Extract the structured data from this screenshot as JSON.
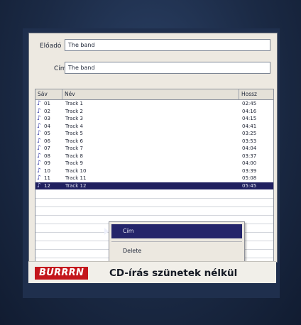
{
  "form": {
    "artist_label": "Előadó",
    "artist_value": "The band",
    "title_label": "Cím",
    "title_value": "The band"
  },
  "table": {
    "columns": [
      "Sáv",
      "Név",
      "Hossz"
    ],
    "rows": [
      {
        "num": "01",
        "name": "Track 1",
        "length": "02:45"
      },
      {
        "num": "02",
        "name": "Track 2",
        "length": "04:16"
      },
      {
        "num": "03",
        "name": "Track 3",
        "length": "04:15"
      },
      {
        "num": "04",
        "name": "Track 4",
        "length": "04:41"
      },
      {
        "num": "05",
        "name": "Track 5",
        "length": "03:25"
      },
      {
        "num": "06",
        "name": "Track 6",
        "length": "03:53"
      },
      {
        "num": "07",
        "name": "Track 7",
        "length": "04:04"
      },
      {
        "num": "08",
        "name": "Track 8",
        "length": "03:37"
      },
      {
        "num": "09",
        "name": "Track 9",
        "length": "04:00"
      },
      {
        "num": "10",
        "name": "Track 10",
        "length": "03:39"
      },
      {
        "num": "11",
        "name": "Track 11",
        "length": "05:08"
      },
      {
        "num": "12",
        "name": "Track 12",
        "length": "05:45"
      }
    ],
    "selected_index": 11
  },
  "context_menu": {
    "items": [
      "Cím",
      "Delete"
    ]
  },
  "caption": {
    "badge": "BURRRN",
    "text": "CD-írás szünetek nélkül"
  },
  "colors": {
    "selection": "#20205f",
    "badge": "#c4161c",
    "background": "#1b2a45"
  }
}
